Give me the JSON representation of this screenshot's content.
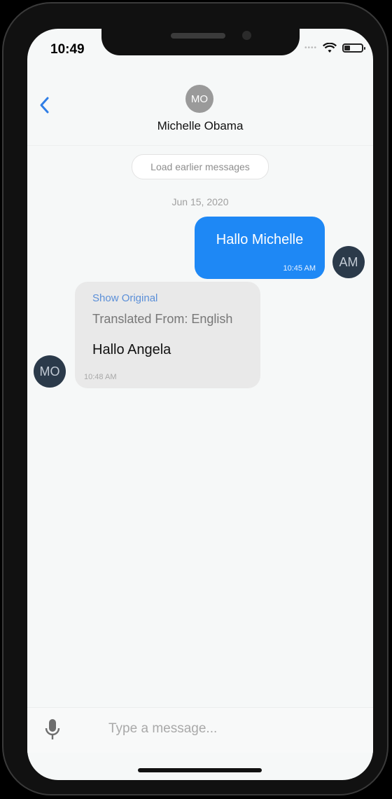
{
  "status_bar": {
    "time": "10:49"
  },
  "header": {
    "back_icon": "chevron-left-icon",
    "avatar_initials": "MO",
    "contact_name": "Michelle Obama"
  },
  "chat": {
    "load_earlier_label": "Load earlier messages",
    "date_label": "Jun 15, 2020",
    "messages": [
      {
        "direction": "outgoing",
        "text": "Hallo Michelle",
        "time": "10:45 AM",
        "avatar": "AM"
      },
      {
        "direction": "incoming",
        "show_original": "Show Original",
        "translated_from": "Translated From: English",
        "text": "Hallo Angela",
        "time": "10:48 AM",
        "avatar": "MO"
      }
    ]
  },
  "composer": {
    "placeholder": "Type a message...",
    "mic_icon": "microphone-icon"
  },
  "colors": {
    "accent": "#1e88f5",
    "link": "#5b8fd8",
    "incoming_bubble": "#e9e9e9",
    "avatar_dark": "#2b3a4a"
  }
}
